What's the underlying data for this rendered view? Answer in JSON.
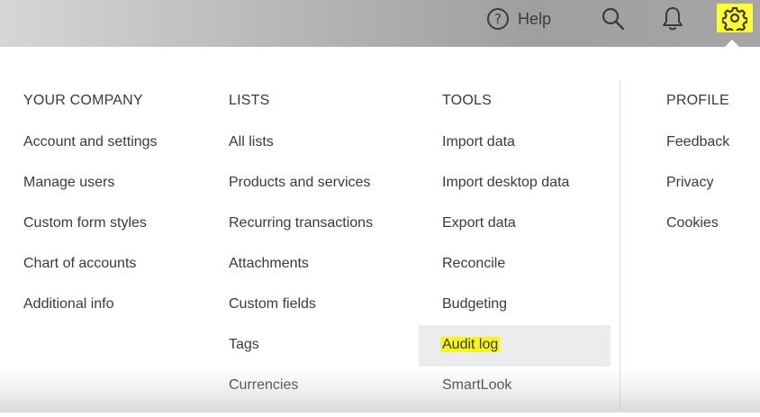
{
  "topbar": {
    "help_label": "Help",
    "help_icon_glyph": "?",
    "icons": [
      "help-circle-icon",
      "search-icon",
      "bell-icon",
      "gear-icon"
    ],
    "gear_highlight_color": "#ffff33"
  },
  "columns": [
    {
      "header": "YOUR COMPANY",
      "items": [
        "Account and settings",
        "Manage users",
        "Custom form styles",
        "Chart of accounts",
        "Additional info"
      ]
    },
    {
      "header": "LISTS",
      "items": [
        "All lists",
        "Products and services",
        "Recurring transactions",
        "Attachments",
        "Custom fields",
        "Tags",
        "Currencies"
      ]
    },
    {
      "header": "TOOLS",
      "items": [
        "Import data",
        "Import desktop data",
        "Export data",
        "Reconcile",
        "Budgeting",
        "Audit log",
        "SmartLook"
      ]
    },
    {
      "header": "PROFILE",
      "items": [
        "Feedback",
        "Privacy",
        "Cookies"
      ]
    }
  ],
  "colors": {
    "text": "#393a3d",
    "hover_bg": "#ececee",
    "highlight": "#f7f51e"
  }
}
